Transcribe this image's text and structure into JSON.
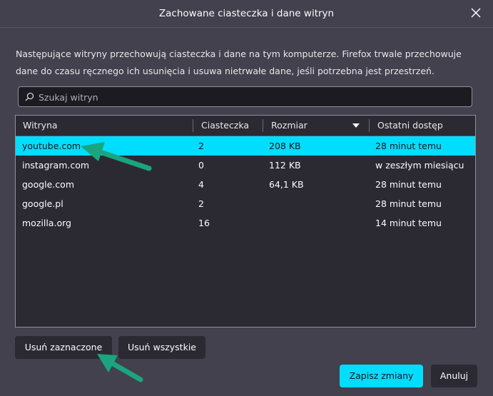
{
  "dialog": {
    "title": "Zachowane ciasteczka i dane witryn",
    "description": "Następujące witryny przechowują ciasteczka i dane na tym komputerze. Firefox trwale przechowuje dane do czasu ręcznego ich usunięcia i usuwa nietrwałe dane, jeśli potrzebna jest przestrzeń."
  },
  "search": {
    "placeholder": "Szukaj witryn",
    "value": ""
  },
  "table": {
    "columns": [
      "Witryna",
      "Ciasteczka",
      "Rozmiar",
      "Ostatni dostęp"
    ],
    "sorted_column": "Rozmiar",
    "rows": [
      {
        "site": "youtube.com",
        "cookies": "2",
        "size": "208 KB",
        "last": "28 minut temu"
      },
      {
        "site": "instagram.com",
        "cookies": "0",
        "size": "112 KB",
        "last": "w zeszłym miesiącu"
      },
      {
        "site": "google.com",
        "cookies": "4",
        "size": "64,1 KB",
        "last": "28 minut temu"
      },
      {
        "site": "google.pl",
        "cookies": "2",
        "size": "",
        "last": "28 minut temu"
      },
      {
        "site": "mozilla.org",
        "cookies": "16",
        "size": "",
        "last": "14 minut temu"
      }
    ],
    "selected_row": 0
  },
  "buttons": {
    "remove_selected": "Usuń zaznaczone",
    "remove_all": "Usuń wszystkie",
    "save": "Zapisz zmiany",
    "cancel": "Anuluj"
  },
  "colors": {
    "accent": "#00ddff",
    "annotation_arrow": "#1aa57f",
    "background": "#42414d"
  },
  "icons": [
    "close-icon",
    "search-icon",
    "sort-descending-icon"
  ]
}
